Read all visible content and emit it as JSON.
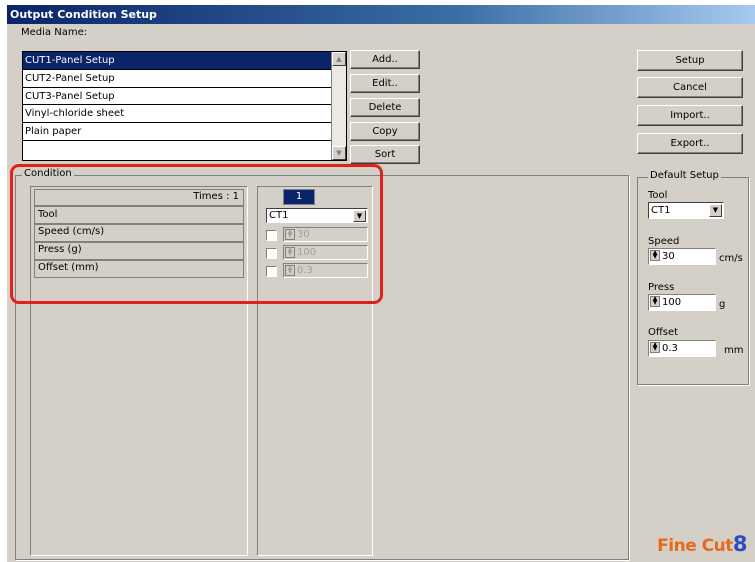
{
  "window": {
    "title": "Output Condition Setup"
  },
  "media": {
    "label": "Media Name:",
    "items": [
      "CUT1-Panel Setup",
      "CUT2-Panel Setup",
      "CUT3-Panel Setup",
      "Vinyl-chloride sheet",
      "Plain paper",
      ""
    ],
    "selected_index": 0
  },
  "buttons": {
    "add": "Add..",
    "edit": "Edit..",
    "delete": "Delete",
    "copy": "Copy",
    "sort": "Sort",
    "setup": "Setup",
    "cancel": "Cancel",
    "import": "Import..",
    "export": "Export.."
  },
  "condition": {
    "label": "Condition",
    "times_label": "Times : 1",
    "rows": [
      "Tool",
      "Speed (cm/s)",
      "Press (g)",
      "Offset (mm)"
    ],
    "column_header": "1",
    "tool_value": "CT1",
    "speed_value": "30",
    "press_value": "100",
    "offset_value": "0.3"
  },
  "default_setup": {
    "label": "Default Setup",
    "tool_label": "Tool",
    "tool_value": "CT1",
    "speed_label": "Speed",
    "speed_value": "30",
    "speed_unit": "cm/s",
    "press_label": "Press",
    "press_value": "100",
    "press_unit": "g",
    "offset_label": "Offset",
    "offset_value": "0.3",
    "offset_unit": "mm"
  },
  "logo": {
    "text_a": "Fine Cut",
    "text_b": "8"
  },
  "colors": {
    "title_bar": "#0a246a",
    "selection": "#0a246a",
    "highlight_box": "#e0201a",
    "logo": "#e76a1e"
  }
}
